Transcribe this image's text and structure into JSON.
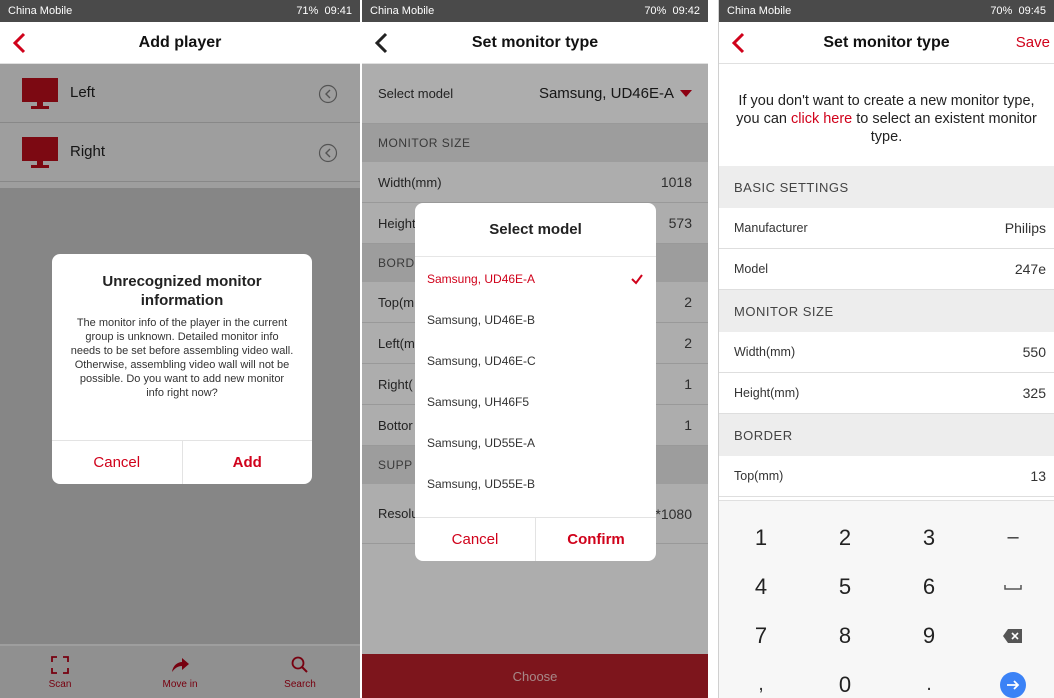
{
  "colors": {
    "accent": "#d0021b",
    "status_bar": "#4a4a4a",
    "section_bg": "#e8e8e8",
    "enter_key": "#3b82f6"
  },
  "screen1": {
    "status": {
      "carrier": "China Mobile",
      "battery": "71%",
      "time": "09:41"
    },
    "title": "Add player",
    "players": [
      {
        "name": "Left"
      },
      {
        "name": "Right"
      }
    ],
    "dialog": {
      "title": "Unrecognized monitor information",
      "message": "The monitor info of the player in the current group is unknown. Detailed monitor info needs to be set before assembling video wall. Otherwise, assembling video wall will not be possible. Do you want to add new monitor info right now?",
      "cancel": "Cancel",
      "add": "Add"
    },
    "tabs": [
      {
        "label": "Scan",
        "icon": "scan-icon"
      },
      {
        "label": "Move in",
        "icon": "share-arrow-icon"
      },
      {
        "label": "Search",
        "icon": "search-icon"
      }
    ]
  },
  "screen2": {
    "status": {
      "carrier": "China Mobile",
      "battery": "70%",
      "time": "09:42"
    },
    "title": "Set monitor type",
    "select_model_label": "Select model",
    "select_model_value": "Samsung, UD46E-A",
    "sections": {
      "monitor_size": "MONITOR SIZE",
      "border": "BORD",
      "support": "SUPP"
    },
    "rows": {
      "width": {
        "label": "Width(mm)",
        "value": "1018"
      },
      "height": {
        "label": "Height",
        "value": "573"
      },
      "top": {
        "label": "Top(m",
        "value": "2"
      },
      "left": {
        "label": "Left(m",
        "value": "2"
      },
      "right": {
        "label": "Right(",
        "value": "1"
      },
      "bottom": {
        "label": "Bottor",
        "value": "1"
      },
      "resolution": {
        "label": "Resolu",
        "value": "*1080"
      }
    },
    "dialog": {
      "title": "Select model",
      "options": [
        "Samsung, UD46E-A",
        "Samsung, UD46E-B",
        "Samsung, UD46E-C",
        "Samsung, UH46F5",
        "Samsung, UD55E-A",
        "Samsung, UD55E-B"
      ],
      "selected_index": 0,
      "cancel": "Cancel",
      "confirm": "Confirm"
    },
    "choose_label": "Choose"
  },
  "screen3": {
    "status": {
      "carrier": "China Mobile",
      "battery": "70%",
      "time": "09:45"
    },
    "title": "Set monitor type",
    "save": "Save",
    "intro_before": "If you don't want to create a new monitor type, you can ",
    "intro_link": "click here",
    "intro_after": " to select an existent monitor type.",
    "sections": {
      "basic": "BASIC SETTINGS",
      "monitor_size": "MONITOR SIZE",
      "border": "BORDER"
    },
    "rows": {
      "manufacturer": {
        "label": "Manufacturer",
        "value": "Philips"
      },
      "model": {
        "label": "Model",
        "value": "247e"
      },
      "width": {
        "label": "Width(mm)",
        "value": "550"
      },
      "height": {
        "label": "Height(mm)",
        "value": "325"
      },
      "top": {
        "label": "Top(mm)",
        "value": "13"
      }
    },
    "keypad": {
      "digits": [
        "1",
        "2",
        "3",
        "4",
        "5",
        "6",
        "7",
        "8",
        "9",
        "0"
      ],
      "minus": "–",
      "comma": ",",
      "dot": "."
    }
  }
}
